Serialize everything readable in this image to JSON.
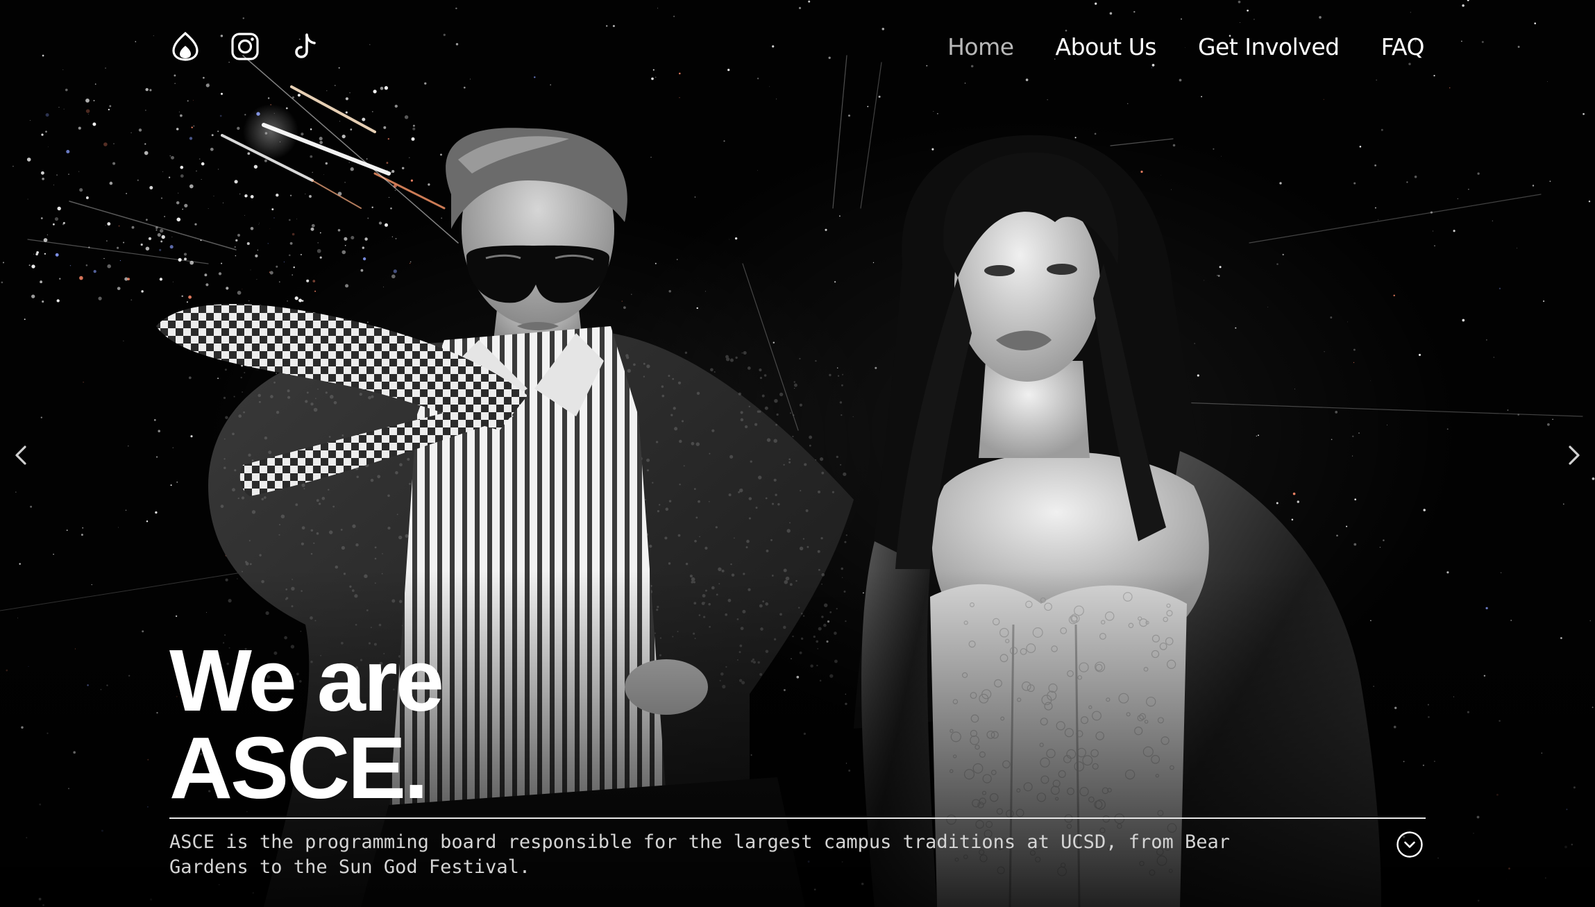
{
  "social": [
    {
      "name": "asce-logo",
      "icon": "flame-logo-icon"
    },
    {
      "name": "instagram",
      "icon": "instagram-icon"
    },
    {
      "name": "tiktok",
      "icon": "tiktok-icon"
    }
  ],
  "nav": {
    "items": [
      {
        "label": "Home",
        "active": true
      },
      {
        "label": "About Us",
        "active": false
      },
      {
        "label": "Get Involved",
        "active": false
      },
      {
        "label": "FAQ",
        "active": false
      }
    ]
  },
  "hero": {
    "title_line1": "We are",
    "title_line2": "ASCE.",
    "description": "ASCE is the programming board responsible for the largest campus traditions at UCSD, from Bear Gardens to the Sun God Festival."
  },
  "carousel": {
    "prev_icon": "chevron-left-icon",
    "next_icon": "chevron-right-icon"
  },
  "scroll": {
    "icon": "chevron-down-circle-icon"
  },
  "colors": {
    "background": "#000000",
    "text": "#ffffff",
    "nav_active": "#b8b8b8",
    "description": "#d4d4d4"
  }
}
